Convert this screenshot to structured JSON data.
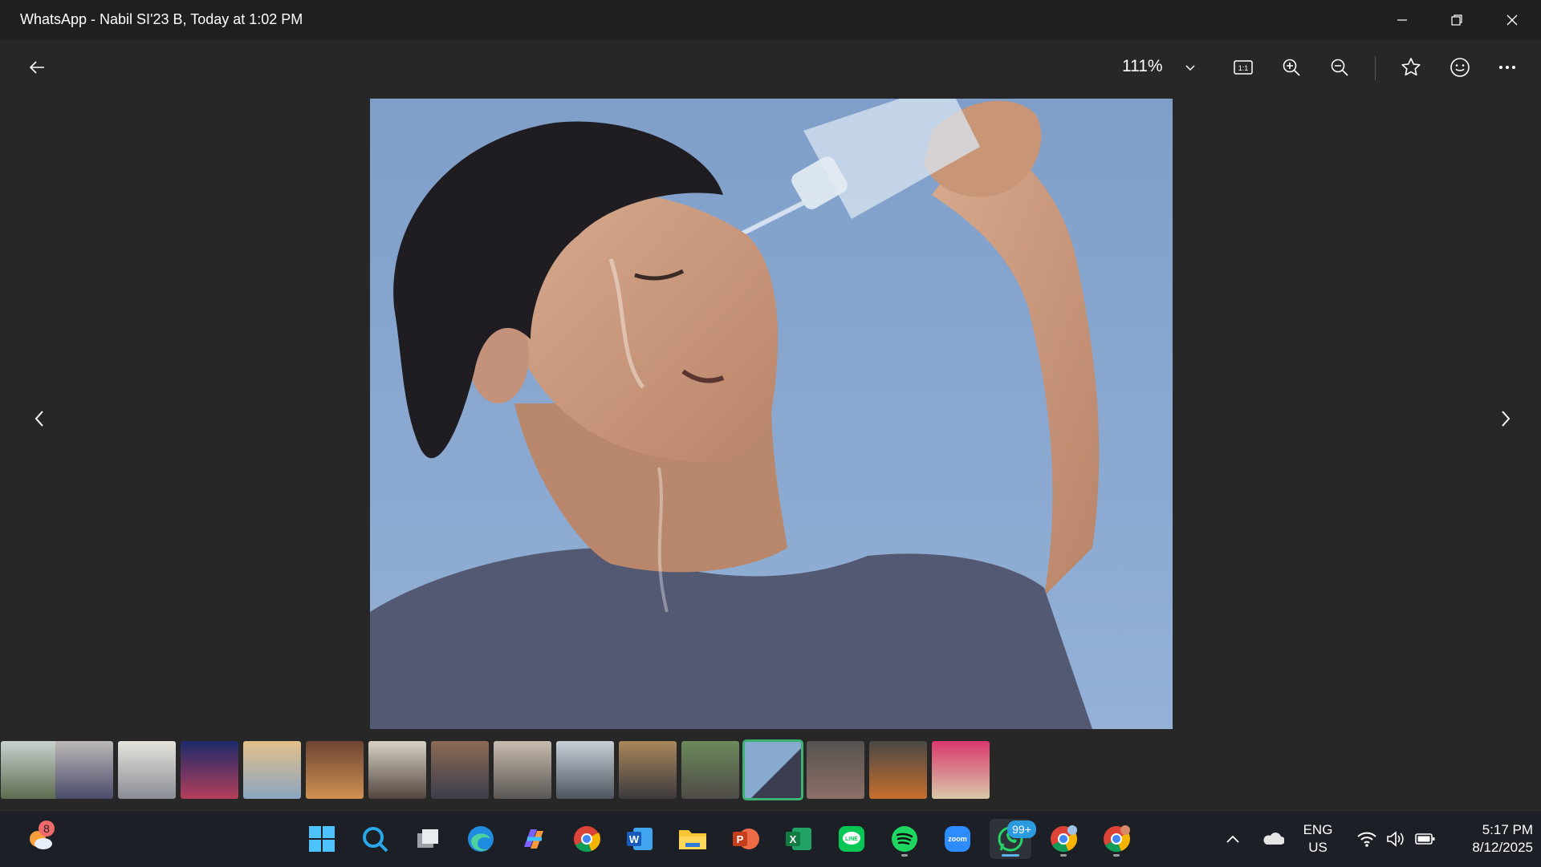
{
  "window": {
    "title": "WhatsApp - Nabil SI'23 B, Today at 1:02 PM"
  },
  "toolbar": {
    "zoom": "111%"
  },
  "photo": {
    "description_icon": "photo-man-pouring-water"
  },
  "filmstrip": {
    "count": 16,
    "selected_index": 12
  },
  "taskbar": {
    "weather_badge": "8",
    "whatsapp_badge": "99+",
    "lang_line1": "ENG",
    "lang_line2": "US",
    "time": "5:17 PM",
    "date": "8/12/2025",
    "zoom_label": "zoom"
  },
  "colors": {
    "accent": "#3cb371",
    "taskbar": "#1c1f25",
    "background": "#272727"
  }
}
